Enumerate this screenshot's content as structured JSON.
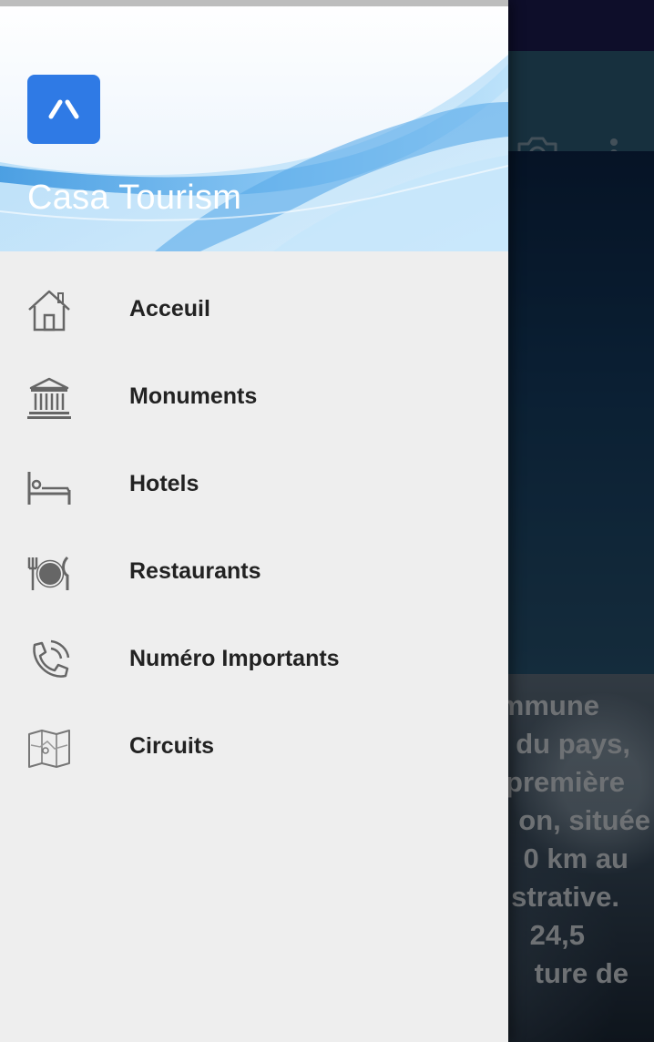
{
  "background": {
    "toolbar_icons": [
      "camera-icon",
      "overflow-menu-icon"
    ],
    "text_lines": [
      "mmune",
      "du pays,",
      "première",
      "on, située",
      "0 km au",
      "strative.",
      "24,5",
      "ture de"
    ]
  },
  "drawer": {
    "app_name": "Casa Tourism",
    "logo_icon": "app-logo-icon",
    "items": [
      {
        "label": "Acceuil",
        "icon": "home-icon"
      },
      {
        "label": "Monuments",
        "icon": "monument-icon"
      },
      {
        "label": "Hotels",
        "icon": "bed-icon"
      },
      {
        "label": "Restaurants",
        "icon": "restaurant-icon"
      },
      {
        "label": "Numéro Importants",
        "icon": "phone-icon"
      },
      {
        "label": "Circuits",
        "icon": "map-icon"
      }
    ]
  },
  "colors": {
    "logo_blue": "#2f7ae5",
    "drawer_bg": "#eeeeee",
    "toolbar": "#2b5872",
    "status_bar": "#1a1a4e"
  }
}
